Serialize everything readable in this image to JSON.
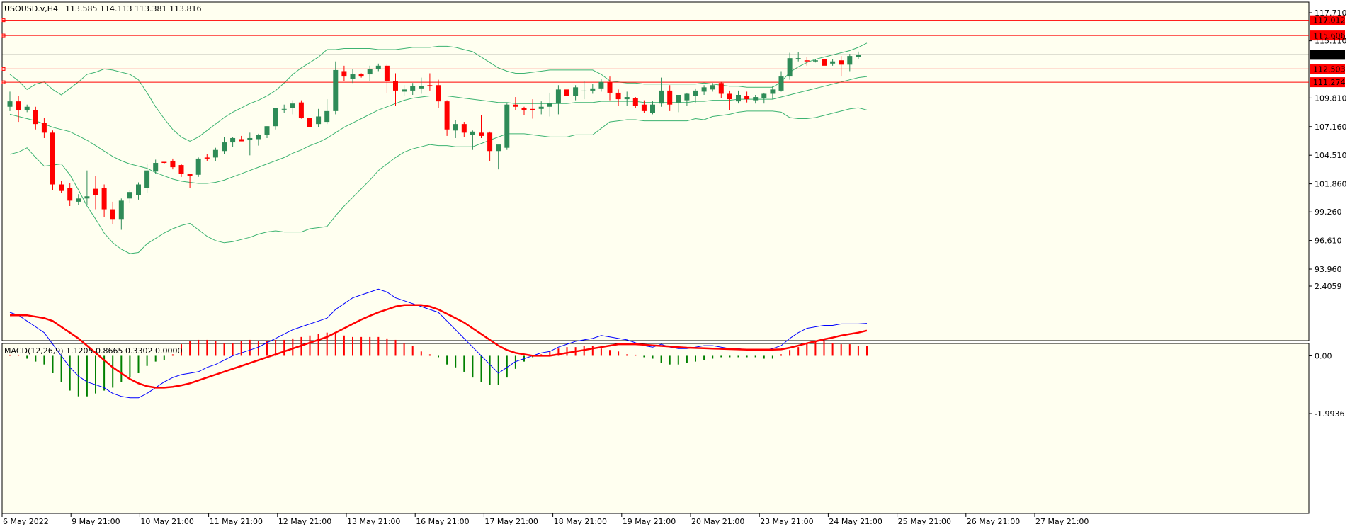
{
  "header": {
    "symbol_tf": "USOUSD.v,H4",
    "ohlc": "113.585 114.113 113.381 113.816"
  },
  "macd_header": {
    "label": "MACD(12,26,9) 1.1205 0.8665 0.3302 0.0000"
  },
  "colors": {
    "background": "#fffff0",
    "bull": "#2e8b57",
    "bear": "#ff0000",
    "bands": "#3cb371",
    "macd_line": "#0000ff",
    "signal_line": "#ff0000",
    "hist_pos": "#ff0000",
    "hist_neg": "#008000",
    "level_line": "#ff0000",
    "price_line": "#000000"
  },
  "price_axis": {
    "ticks": [
      "117.710",
      "115.110",
      "109.810",
      "107.160",
      "104.510",
      "101.860",
      "99.260",
      "96.610",
      "93.960"
    ],
    "tick_values": [
      117.71,
      115.11,
      109.81,
      107.16,
      104.51,
      101.86,
      99.26,
      96.61,
      93.96
    ],
    "ymin": 93.96,
    "ymax": 117.71
  },
  "macd_axis": {
    "ticks": [
      "2.4059",
      "0.00",
      "-1.9936"
    ],
    "tick_values": [
      2.4059,
      0.0,
      -1.9936
    ],
    "ymin": -1.9936,
    "ymax": 2.4059
  },
  "levels": [
    {
      "label": "117.012",
      "value": 117.012
    },
    {
      "label": "115.606",
      "value": 115.606
    },
    {
      "label": "112.503",
      "value": 112.503
    },
    {
      "label": "111.274",
      "value": 111.274
    }
  ],
  "current_price": {
    "label": "113.816",
    "value": 113.816
  },
  "time_axis": [
    "6 May 2022",
    "9 May 21:00",
    "10 May 21:00",
    "11 May 21:00",
    "12 May 21:00",
    "13 May 21:00",
    "16 May 21:00",
    "17 May 21:00",
    "18 May 21:00",
    "19 May 21:00",
    "20 May 21:00",
    "23 May 21:00",
    "24 May 21:00",
    "25 May 21:00",
    "26 May 21:00",
    "27 May 21:00"
  ],
  "chart_data": {
    "type": "candlestick",
    "candles": [
      [
        109.0,
        110.4,
        108.6,
        109.5
      ],
      [
        109.5,
        110.0,
        107.6,
        108.7
      ],
      [
        108.7,
        109.2,
        108.5,
        109.0
      ],
      [
        108.7,
        109.0,
        106.9,
        107.4
      ],
      [
        107.5,
        108.0,
        106.1,
        106.6
      ],
      [
        106.6,
        106.8,
        101.3,
        101.8
      ],
      [
        101.8,
        102.1,
        101.0,
        101.2
      ],
      [
        101.5,
        101.9,
        99.8,
        100.3
      ],
      [
        100.2,
        100.9,
        99.9,
        100.5
      ],
      [
        100.5,
        103.1,
        99.9,
        100.7
      ],
      [
        101.4,
        102.6,
        99.5,
        100.8
      ],
      [
        101.5,
        101.8,
        98.8,
        99.5
      ],
      [
        99.5,
        100.2,
        98.1,
        98.6
      ],
      [
        98.6,
        100.5,
        97.6,
        100.3
      ],
      [
        100.5,
        101.3,
        100.1,
        101.1
      ],
      [
        100.8,
        102.0,
        100.4,
        101.8
      ],
      [
        101.5,
        103.7,
        101.0,
        103.1
      ],
      [
        103.0,
        104.1,
        102.8,
        103.8
      ],
      [
        103.9,
        103.9,
        103.7,
        103.8
      ],
      [
        104.0,
        104.2,
        103.2,
        103.4
      ],
      [
        103.6,
        103.7,
        102.5,
        102.8
      ],
      [
        102.8,
        102.8,
        101.5,
        102.6
      ],
      [
        102.7,
        104.3,
        102.5,
        104.2
      ],
      [
        104.3,
        104.6,
        104.0,
        104.2
      ],
      [
        104.3,
        105.2,
        104.0,
        105.0
      ],
      [
        104.9,
        106.2,
        104.6,
        105.7
      ],
      [
        105.7,
        106.2,
        105.3,
        106.1
      ],
      [
        106.0,
        106.3,
        105.8,
        105.8
      ],
      [
        105.9,
        106.6,
        104.5,
        106.1
      ],
      [
        106.0,
        106.5,
        105.4,
        106.4
      ],
      [
        106.4,
        107.2,
        106.1,
        107.2
      ],
      [
        107.2,
        108.8,
        106.9,
        108.9
      ],
      [
        108.8,
        109.2,
        108.4,
        108.8
      ],
      [
        108.9,
        109.6,
        108.3,
        109.3
      ],
      [
        109.4,
        109.6,
        107.9,
        108.0
      ],
      [
        108.0,
        108.1,
        106.7,
        107.1
      ],
      [
        107.4,
        108.8,
        107.1,
        108.1
      ],
      [
        107.6,
        109.7,
        107.4,
        108.6
      ],
      [
        108.6,
        113.2,
        108.3,
        112.4
      ],
      [
        112.3,
        112.8,
        111.4,
        111.8
      ],
      [
        111.6,
        112.5,
        111.2,
        112.0
      ],
      [
        112.0,
        112.1,
        111.7,
        111.8
      ],
      [
        112.0,
        112.8,
        111.4,
        112.5
      ],
      [
        112.5,
        113.0,
        112.3,
        112.8
      ],
      [
        112.8,
        112.9,
        110.3,
        111.4
      ],
      [
        111.4,
        112.1,
        109.1,
        110.5
      ],
      [
        110.4,
        111.0,
        110.0,
        110.6
      ],
      [
        110.5,
        111.2,
        110.1,
        110.9
      ],
      [
        110.7,
        111.7,
        110.2,
        110.9
      ],
      [
        111.0,
        112.1,
        110.5,
        110.9
      ],
      [
        111.0,
        111.5,
        108.9,
        109.5
      ],
      [
        109.5,
        109.6,
        106.3,
        106.9
      ],
      [
        106.8,
        107.8,
        106.1,
        107.4
      ],
      [
        107.4,
        107.6,
        106.2,
        106.6
      ],
      [
        106.4,
        106.8,
        105.0,
        106.7
      ],
      [
        106.6,
        108.2,
        106.1,
        106.3
      ],
      [
        106.6,
        106.7,
        104.0,
        104.9
      ],
      [
        104.9,
        105.1,
        103.2,
        105.5
      ],
      [
        105.2,
        109.3,
        105.0,
        109.2
      ],
      [
        109.2,
        109.9,
        108.7,
        109.0
      ],
      [
        108.9,
        109.0,
        108.2,
        108.7
      ],
      [
        108.8,
        109.7,
        107.9,
        108.7
      ],
      [
        108.8,
        109.5,
        108.3,
        109.0
      ],
      [
        109.0,
        110.3,
        108.1,
        109.3
      ],
      [
        109.3,
        111.0,
        108.3,
        110.6
      ],
      [
        110.6,
        111.0,
        110.0,
        110.0
      ],
      [
        110.0,
        111.0,
        109.6,
        110.8
      ],
      [
        110.5,
        111.4,
        109.7,
        110.5
      ],
      [
        110.5,
        111.1,
        110.2,
        110.7
      ],
      [
        110.7,
        111.6,
        110.4,
        111.3
      ],
      [
        111.3,
        111.8,
        109.6,
        110.3
      ],
      [
        110.3,
        110.6,
        109.1,
        109.7
      ],
      [
        109.7,
        110.4,
        109.1,
        109.9
      ],
      [
        109.8,
        109.9,
        108.9,
        109.1
      ],
      [
        109.2,
        109.6,
        108.4,
        108.6
      ],
      [
        108.4,
        109.5,
        108.3,
        109.2
      ],
      [
        109.3,
        111.7,
        109.0,
        110.5
      ],
      [
        110.5,
        111.0,
        108.6,
        109.2
      ],
      [
        109.4,
        110.1,
        108.5,
        110.1
      ],
      [
        109.6,
        110.3,
        109.1,
        110.2
      ],
      [
        110.0,
        110.7,
        109.4,
        110.5
      ],
      [
        110.4,
        111.0,
        110.1,
        110.8
      ],
      [
        110.6,
        111.2,
        110.4,
        111.0
      ],
      [
        111.2,
        111.3,
        109.8,
        110.2
      ],
      [
        110.2,
        110.5,
        108.7,
        109.7
      ],
      [
        109.5,
        110.5,
        109.3,
        110.1
      ],
      [
        110.0,
        110.4,
        109.4,
        109.7
      ],
      [
        109.6,
        110.1,
        109.3,
        109.9
      ],
      [
        109.8,
        110.3,
        109.3,
        110.2
      ],
      [
        110.2,
        110.9,
        109.7,
        110.6
      ],
      [
        110.5,
        112.3,
        110.4,
        111.8
      ],
      [
        111.8,
        114.0,
        111.5,
        113.5
      ],
      [
        113.5,
        114.1,
        113.2,
        113.5
      ],
      [
        113.3,
        113.6,
        112.8,
        113.2
      ],
      [
        113.2,
        113.4,
        113.1,
        113.3
      ],
      [
        113.4,
        113.6,
        112.6,
        112.8
      ],
      [
        113.0,
        113.4,
        112.8,
        113.2
      ],
      [
        113.3,
        113.7,
        111.8,
        112.9
      ],
      [
        112.9,
        113.9,
        112.3,
        113.7
      ],
      [
        113.585,
        114.113,
        113.381,
        113.816
      ]
    ],
    "bb_upper": [
      112.0,
      111.4,
      110.6,
      111.1,
      111.3,
      110.6,
      110.1,
      110.7,
      111.3,
      112.0,
      112.2,
      112.5,
      112.4,
      112.2,
      112.0,
      111.5,
      110.3,
      109.0,
      107.9,
      106.9,
      106.2,
      105.8,
      106.2,
      106.8,
      107.4,
      108.0,
      108.5,
      108.9,
      109.3,
      109.6,
      110.0,
      110.5,
      111.2,
      112.0,
      112.6,
      113.1,
      113.6,
      114.3,
      114.3,
      114.4,
      114.4,
      114.4,
      114.4,
      114.3,
      114.3,
      114.3,
      114.4,
      114.5,
      114.5,
      114.5,
      114.6,
      114.6,
      114.5,
      114.3,
      114.1,
      113.6,
      113.1,
      112.6,
      112.3,
      112.1,
      112.1,
      112.2,
      112.3,
      112.4,
      112.4,
      112.4,
      112.4,
      112.4,
      112.4,
      112.0,
      111.4,
      111.3,
      111.2,
      111.2,
      111.1,
      111.1,
      111.1,
      111.1,
      111.1,
      111.1,
      111.1,
      111.2,
      111.1,
      111.0,
      110.9,
      110.9,
      110.8,
      110.8,
      110.8,
      110.8,
      111.3,
      112.2,
      112.7,
      113.1,
      113.4,
      113.6,
      113.8,
      114.0,
      114.2,
      114.5,
      114.9
    ],
    "bb_mid": [
      108.3,
      108.1,
      107.9,
      107.7,
      107.4,
      107.1,
      106.9,
      106.7,
      106.3,
      105.9,
      105.4,
      104.9,
      104.4,
      104.0,
      103.7,
      103.5,
      103.3,
      102.9,
      102.6,
      102.3,
      102.1,
      102.0,
      101.9,
      101.9,
      102.0,
      102.2,
      102.5,
      102.8,
      103.1,
      103.4,
      103.7,
      104.0,
      104.3,
      104.7,
      105.0,
      105.4,
      105.7,
      106.1,
      106.6,
      107.1,
      107.5,
      107.9,
      108.3,
      108.7,
      109.0,
      109.3,
      109.6,
      109.8,
      109.9,
      110.0,
      110.0,
      110.0,
      109.9,
      109.8,
      109.7,
      109.6,
      109.5,
      109.4,
      109.4,
      109.3,
      109.3,
      109.3,
      109.3,
      109.3,
      109.3,
      109.3,
      109.4,
      109.4,
      109.4,
      109.5,
      109.5,
      109.5,
      109.5,
      109.5,
      109.4,
      109.4,
      109.4,
      109.4,
      109.4,
      109.4,
      109.5,
      109.5,
      109.6,
      109.6,
      109.6,
      109.7,
      109.7,
      109.7,
      109.7,
      109.7,
      109.9,
      110.1,
      110.3,
      110.5,
      110.7,
      110.9,
      111.1,
      111.3,
      111.5,
      111.7,
      111.8
    ],
    "bb_lower": [
      104.6,
      104.8,
      105.2,
      104.3,
      103.5,
      103.6,
      103.7,
      102.7,
      101.3,
      99.8,
      98.6,
      97.3,
      96.4,
      95.8,
      95.4,
      95.5,
      96.3,
      96.8,
      97.3,
      97.7,
      98.0,
      98.2,
      97.6,
      97.0,
      96.6,
      96.4,
      96.5,
      96.7,
      96.9,
      97.2,
      97.4,
      97.5,
      97.4,
      97.4,
      97.4,
      97.7,
      97.8,
      97.9,
      98.9,
      99.8,
      100.6,
      101.4,
      102.2,
      103.1,
      103.7,
      104.3,
      104.8,
      105.1,
      105.3,
      105.5,
      105.4,
      105.4,
      105.3,
      105.3,
      105.3,
      105.6,
      105.9,
      106.2,
      106.5,
      106.5,
      106.5,
      106.4,
      106.3,
      106.2,
      106.2,
      106.2,
      106.4,
      106.4,
      106.4,
      107.0,
      107.6,
      107.7,
      107.8,
      107.8,
      107.7,
      107.7,
      107.7,
      107.7,
      107.7,
      107.7,
      107.9,
      107.8,
      108.1,
      108.2,
      108.3,
      108.5,
      108.6,
      108.6,
      108.6,
      108.6,
      108.5,
      108.0,
      107.9,
      107.9,
      108.0,
      108.2,
      108.4,
      108.6,
      108.8,
      108.9,
      108.7
    ],
    "macd": {
      "macd_line": [
        1.5,
        1.4,
        1.2,
        1.0,
        0.8,
        0.4,
        0.0,
        -0.4,
        -0.7,
        -0.9,
        -1.0,
        -1.1,
        -1.3,
        -1.4,
        -1.45,
        -1.45,
        -1.3,
        -1.1,
        -0.9,
        -0.75,
        -0.65,
        -0.6,
        -0.55,
        -0.4,
        -0.3,
        -0.15,
        0.0,
        0.1,
        0.2,
        0.3,
        0.45,
        0.6,
        0.75,
        0.9,
        1.0,
        1.1,
        1.2,
        1.3,
        1.6,
        1.8,
        2.0,
        2.1,
        2.2,
        2.3,
        2.2,
        2.0,
        1.9,
        1.8,
        1.7,
        1.6,
        1.5,
        1.2,
        0.9,
        0.6,
        0.3,
        0.0,
        -0.3,
        -0.6,
        -0.4,
        -0.2,
        -0.1,
        0.0,
        0.1,
        0.15,
        0.3,
        0.4,
        0.5,
        0.55,
        0.6,
        0.7,
        0.65,
        0.6,
        0.55,
        0.45,
        0.35,
        0.3,
        0.4,
        0.3,
        0.25,
        0.25,
        0.3,
        0.35,
        0.35,
        0.3,
        0.25,
        0.25,
        0.2,
        0.2,
        0.2,
        0.25,
        0.35,
        0.6,
        0.8,
        0.95,
        1.0,
        1.05,
        1.05,
        1.1,
        1.1,
        1.1,
        1.12
      ],
      "signal_line": [
        1.4,
        1.4,
        1.4,
        1.35,
        1.3,
        1.2,
        1.0,
        0.8,
        0.6,
        0.35,
        0.1,
        -0.15,
        -0.4,
        -0.6,
        -0.8,
        -0.95,
        -1.05,
        -1.1,
        -1.1,
        -1.07,
        -1.02,
        -0.95,
        -0.85,
        -0.75,
        -0.65,
        -0.55,
        -0.45,
        -0.35,
        -0.25,
        -0.15,
        -0.05,
        0.05,
        0.15,
        0.25,
        0.35,
        0.45,
        0.55,
        0.65,
        0.8,
        0.95,
        1.1,
        1.25,
        1.38,
        1.5,
        1.6,
        1.7,
        1.75,
        1.75,
        1.75,
        1.7,
        1.6,
        1.45,
        1.3,
        1.15,
        0.95,
        0.75,
        0.55,
        0.35,
        0.2,
        0.1,
        0.05,
        0.0,
        0.0,
        0.0,
        0.05,
        0.1,
        0.15,
        0.2,
        0.25,
        0.3,
        0.35,
        0.4,
        0.4,
        0.4,
        0.38,
        0.36,
        0.34,
        0.32,
        0.3,
        0.28,
        0.27,
        0.26,
        0.25,
        0.24,
        0.23,
        0.22,
        0.21,
        0.21,
        0.21,
        0.21,
        0.22,
        0.28,
        0.35,
        0.43,
        0.5,
        0.57,
        0.63,
        0.7,
        0.75,
        0.8,
        0.87
      ],
      "histogram": [
        0.0,
        0.0,
        -0.1,
        -0.2,
        -0.3,
        -0.6,
        -0.9,
        -1.2,
        -1.4,
        -1.4,
        -1.3,
        -1.2,
        -1.1,
        -0.9,
        -0.75,
        -0.6,
        -0.35,
        -0.2,
        -0.15,
        0.05,
        0.4,
        0.5,
        0.55,
        0.55,
        0.5,
        0.45,
        0.45,
        0.5,
        0.55,
        0.5,
        0.5,
        0.55,
        0.55,
        0.6,
        0.65,
        0.7,
        0.75,
        0.8,
        0.75,
        0.7,
        0.65,
        0.65,
        0.65,
        0.65,
        0.6,
        0.55,
        0.45,
        0.35,
        0.15,
        0.05,
        -0.05,
        -0.3,
        -0.4,
        -0.55,
        -0.75,
        -0.9,
        -1.0,
        -1.0,
        -0.75,
        -0.45,
        -0.2,
        -0.05,
        0.05,
        0.15,
        0.25,
        0.3,
        0.3,
        0.35,
        0.35,
        0.25,
        0.2,
        0.15,
        0.05,
        0.0,
        -0.05,
        -0.1,
        -0.25,
        -0.3,
        -0.3,
        -0.25,
        -0.2,
        -0.15,
        -0.1,
        -0.05,
        -0.05,
        -0.05,
        -0.05,
        -0.05,
        -0.1,
        -0.1,
        0.05,
        0.2,
        0.3,
        0.45,
        0.5,
        0.5,
        0.45,
        0.4,
        0.4,
        0.35,
        0.3302
      ]
    }
  }
}
